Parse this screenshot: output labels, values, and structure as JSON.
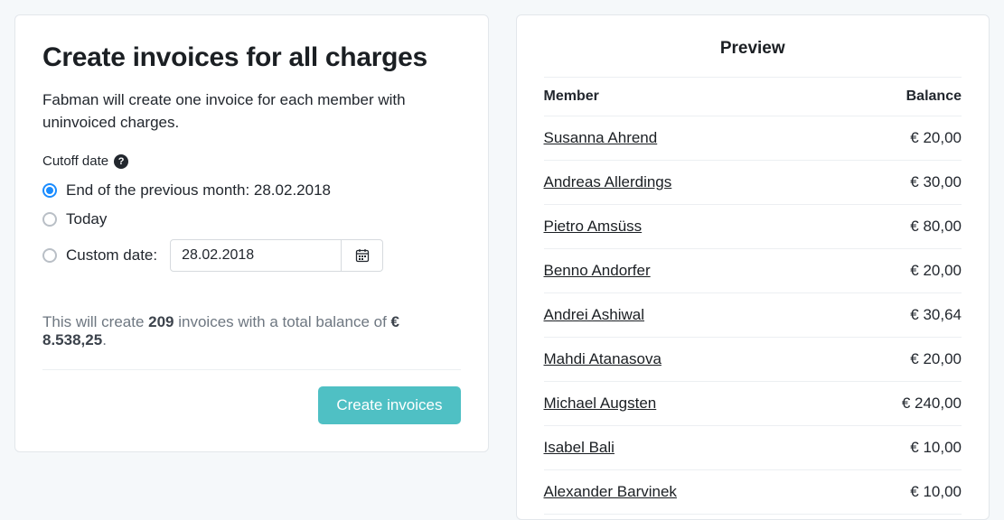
{
  "left": {
    "title": "Create invoices for all charges",
    "description": "Fabman will create one invoice for each member with uninvoiced charges.",
    "cutoff_label": "Cutoff date",
    "options": {
      "prev_month": "End of the previous month: 28.02.2018",
      "today": "Today",
      "custom_label": "Custom date:",
      "custom_value": "28.02.2018"
    },
    "summary": {
      "prefix": "This will create ",
      "count": "209",
      "mid": " invoices with a total balance of ",
      "total": "€ 8.538,25",
      "suffix": "."
    },
    "create_button": "Create invoices"
  },
  "preview": {
    "title": "Preview",
    "header_member": "Member",
    "header_balance": "Balance",
    "rows": [
      {
        "name": "Susanna Ahrend",
        "balance": "€ 20,00"
      },
      {
        "name": "Andreas Allerdings",
        "balance": "€ 30,00"
      },
      {
        "name": "Pietro Amsüss",
        "balance": "€ 80,00"
      },
      {
        "name": "Benno Andorfer",
        "balance": "€ 20,00"
      },
      {
        "name": "Andrei Ashiwal",
        "balance": "€ 30,64"
      },
      {
        "name": "Mahdi Atanasova",
        "balance": "€ 20,00"
      },
      {
        "name": "Michael Augsten",
        "balance": "€ 240,00"
      },
      {
        "name": "Isabel Bali",
        "balance": "€ 10,00"
      },
      {
        "name": "Alexander Barvinek",
        "balance": "€ 10,00"
      }
    ]
  }
}
